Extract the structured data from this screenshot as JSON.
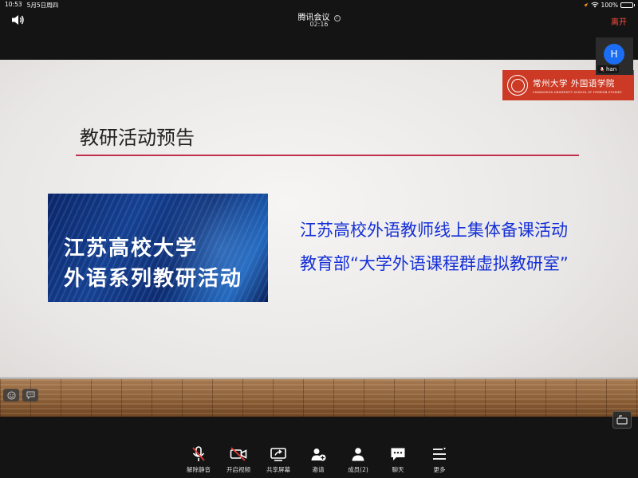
{
  "status_bar": {
    "time": "10:53",
    "date": "5月5日周四",
    "battery": "100%"
  },
  "meeting": {
    "title": "腾讯会议",
    "timer": "02:16",
    "leave_label": "离开"
  },
  "participant": {
    "avatar_initial": "H",
    "name": "han",
    "avatar_color": "#1b6ef3"
  },
  "slide": {
    "logo_cn": "常州大学 外国语学院",
    "logo_en": "CHANGZHOU UNIVERSITY   SCHOOL OF FOREIGN STUDIES",
    "title": "教研活动预告",
    "banner_line1": "江苏高校大学",
    "banner_line2": "外语系列教研活动",
    "text_line1": "江苏高校外语教师线上集体备课活动",
    "text_line2": "教育部“大学外语课程群虚拟教研室”",
    "accent_color": "#c0304e",
    "text_color": "#1530d8",
    "logo_color": "#cc3a25"
  },
  "toolbar": {
    "mute": "解除静音",
    "video": "开启视频",
    "share": "共享屏幕",
    "invite": "邀请",
    "members": "成员(2)",
    "chat": "聊天",
    "more": "更多"
  },
  "colors": {
    "leave": "#ff4d3d",
    "mute_slash": "#e53935",
    "background": "#141414"
  }
}
